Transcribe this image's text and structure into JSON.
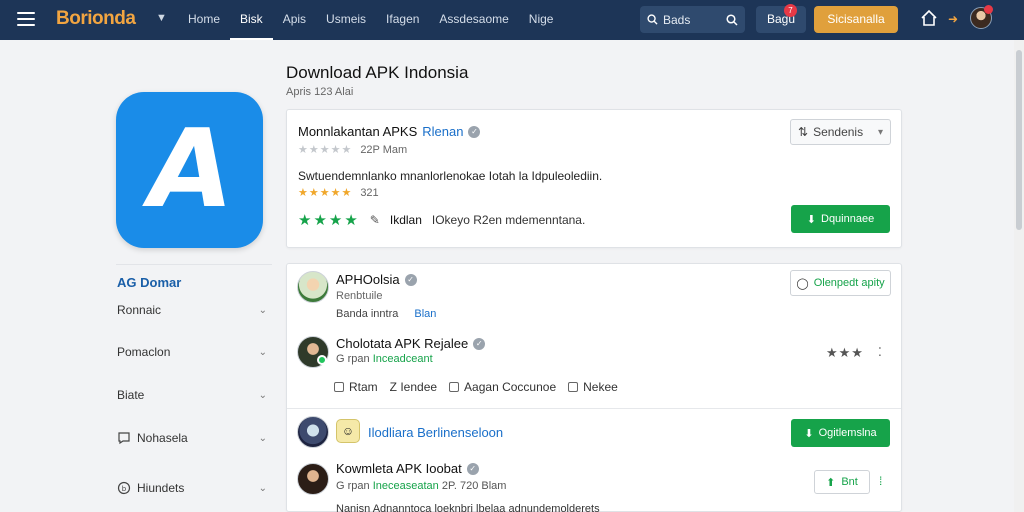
{
  "nav": {
    "logo": "Borionda",
    "links": [
      "Home",
      "Bisk",
      "Apis",
      "Usmeis",
      "Ifagen",
      "Assdesaome",
      "Nige"
    ],
    "active_index": 1,
    "search_label": "Bads",
    "login_label": "Bagu",
    "notification_count": "7",
    "cta_label": "Sicisanalla"
  },
  "sidebar": {
    "heading": "AG Domar",
    "items": [
      {
        "label": "Ronnaic",
        "icon": ""
      },
      {
        "label": "Pomaclon",
        "icon": ""
      },
      {
        "label": "Biate",
        "icon": ""
      },
      {
        "label": "Nohasela",
        "icon": "chat-bubble-icon"
      },
      {
        "label": "Hiundets",
        "icon": "circle-badge-icon"
      }
    ]
  },
  "main": {
    "title": "Download APK Indonsia",
    "subtitle": "Apris 123 Alai",
    "card1": {
      "title": "Monnlakantan APKS",
      "title_highlight": "Rlenan",
      "rating_meta": "22P Mam",
      "description": "Swtuendemnlanko mnanlorlenokae Iotah la Idpuleolediin.",
      "rating2": "321",
      "info_label": "Ikdlan",
      "info_text": "IOkeyo R2en mdemenntana.",
      "sort_label": "Sendenis",
      "download_label": "Dquinnaee"
    },
    "card2": {
      "row1": {
        "name": "APHOolsia",
        "sub": "Renbtuile",
        "meta_a": "Banda inntra",
        "meta_b": "Blan",
        "button": "Olenpedt apity"
      },
      "row2": {
        "name": "Cholotata APK Rejalee",
        "sub_prefix": "G rpan",
        "sub_green": "Inceadceant",
        "checks": [
          "Rtam",
          "Z Iendee",
          "Aagan Coccunoe",
          "Nekee"
        ]
      },
      "row3": {
        "name": "Ilodliara Berlinenseloon",
        "button": "Ogitlemslna"
      },
      "row4": {
        "name": "Kowmleta APK Ioobat",
        "sub_prefix": "G rpan",
        "sub_green": "Ineceaseatan",
        "sub_meta": "2P. 720 Blam",
        "share_label": "Bnt",
        "footer": "Nanisn Adnanntoca loeknbri lbelaa adnundemolderets"
      }
    }
  },
  "colors": {
    "nav_bg": "#1d3557",
    "accent": "#e0a03c",
    "green": "#16a34a",
    "blue": "#1a6fc9",
    "app_icon": "#1a8ce8"
  }
}
